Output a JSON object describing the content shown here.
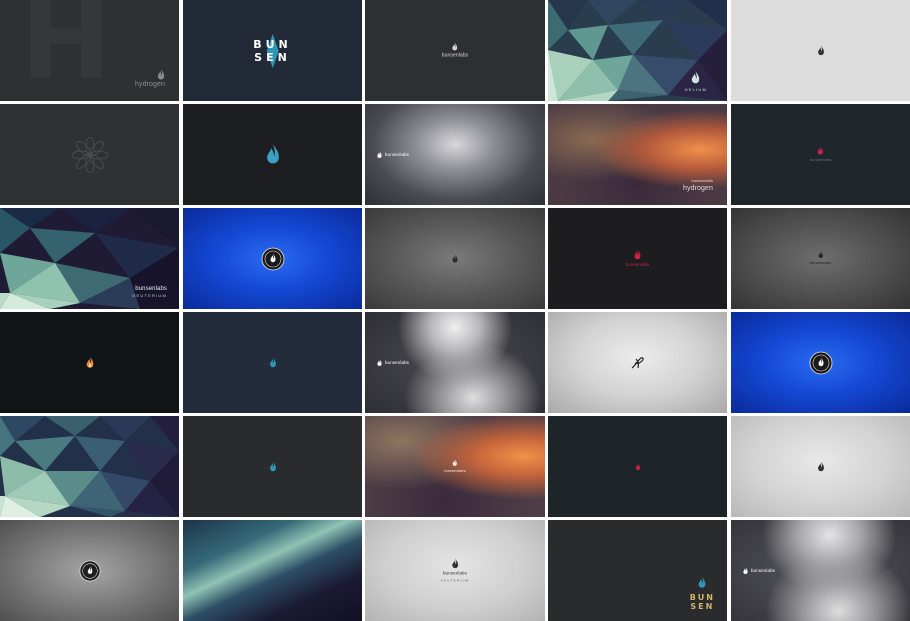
{
  "gallery": {
    "tiles": [
      {
        "id": "hydrogen-h2-dark",
        "label_a": "hydrogen"
      },
      {
        "id": "bunsen-navy",
        "label_a": "BUN",
        "label_b": "SEN"
      },
      {
        "id": "bunsenlabs-charcoal",
        "label_a": "bunsenlabs"
      },
      {
        "id": "helium-polygon",
        "label_a": "HELIUM"
      },
      {
        "id": "flame-light-grey"
      },
      {
        "id": "flower-dark"
      },
      {
        "id": "blue-flame-dark"
      },
      {
        "id": "crystal-grey-bunsenlabs",
        "label_a": "bunsenlabs"
      },
      {
        "id": "blur-orange-hydrogen",
        "label_a": "bunsenlabs",
        "label_b": "hydrogen"
      },
      {
        "id": "red-flame-teal",
        "label_a": "bunsenlabs"
      },
      {
        "id": "polygon-teal-deuterium",
        "label_a": "bunsenlabs",
        "label_b": "DEUTERIUM"
      },
      {
        "id": "blue-badge"
      },
      {
        "id": "grey-gradient-flame"
      },
      {
        "id": "red-flame-black",
        "label_a": "bunsenlabs"
      },
      {
        "id": "grey-gradient-bunsenlabs",
        "label_a": "bunsenlabs"
      },
      {
        "id": "orange-flame-black"
      },
      {
        "id": "blue-flame-navy"
      },
      {
        "id": "crystal-grey-bunsenlabs-2",
        "label_a": "bunsenlabs"
      },
      {
        "id": "swirl-light-grey"
      },
      {
        "id": "blue-badge-2"
      },
      {
        "id": "polygon-teal-2"
      },
      {
        "id": "blue-flame-charcoal"
      },
      {
        "id": "blur-orange-bunsenlabs",
        "label_a": "bunsenlabs"
      },
      {
        "id": "red-flame-dark-teal"
      },
      {
        "id": "flame-light-grey-2"
      },
      {
        "id": "grey-badge"
      },
      {
        "id": "teal-diagonal"
      },
      {
        "id": "bunsenlabs-light-grey",
        "label_a": "bunsenlabs",
        "label_b": "DEUTERIUM"
      },
      {
        "id": "bunsen-teal-corner",
        "label_a": "BUN",
        "label_b": "SEN"
      },
      {
        "id": "crystal-grey-bunsenlabs-3",
        "label_a": "bunsenlabs"
      }
    ]
  },
  "colors": {
    "separator": "#ffffff",
    "bunsen_teal": "#2f97b3",
    "flame_red": "#d0204a",
    "flame_orange": "#f08a3a",
    "badge_ring": "#e8e8e8"
  },
  "icons": [
    "flame-icon",
    "flower-icon",
    "badge-icon",
    "swirl-icon"
  ]
}
